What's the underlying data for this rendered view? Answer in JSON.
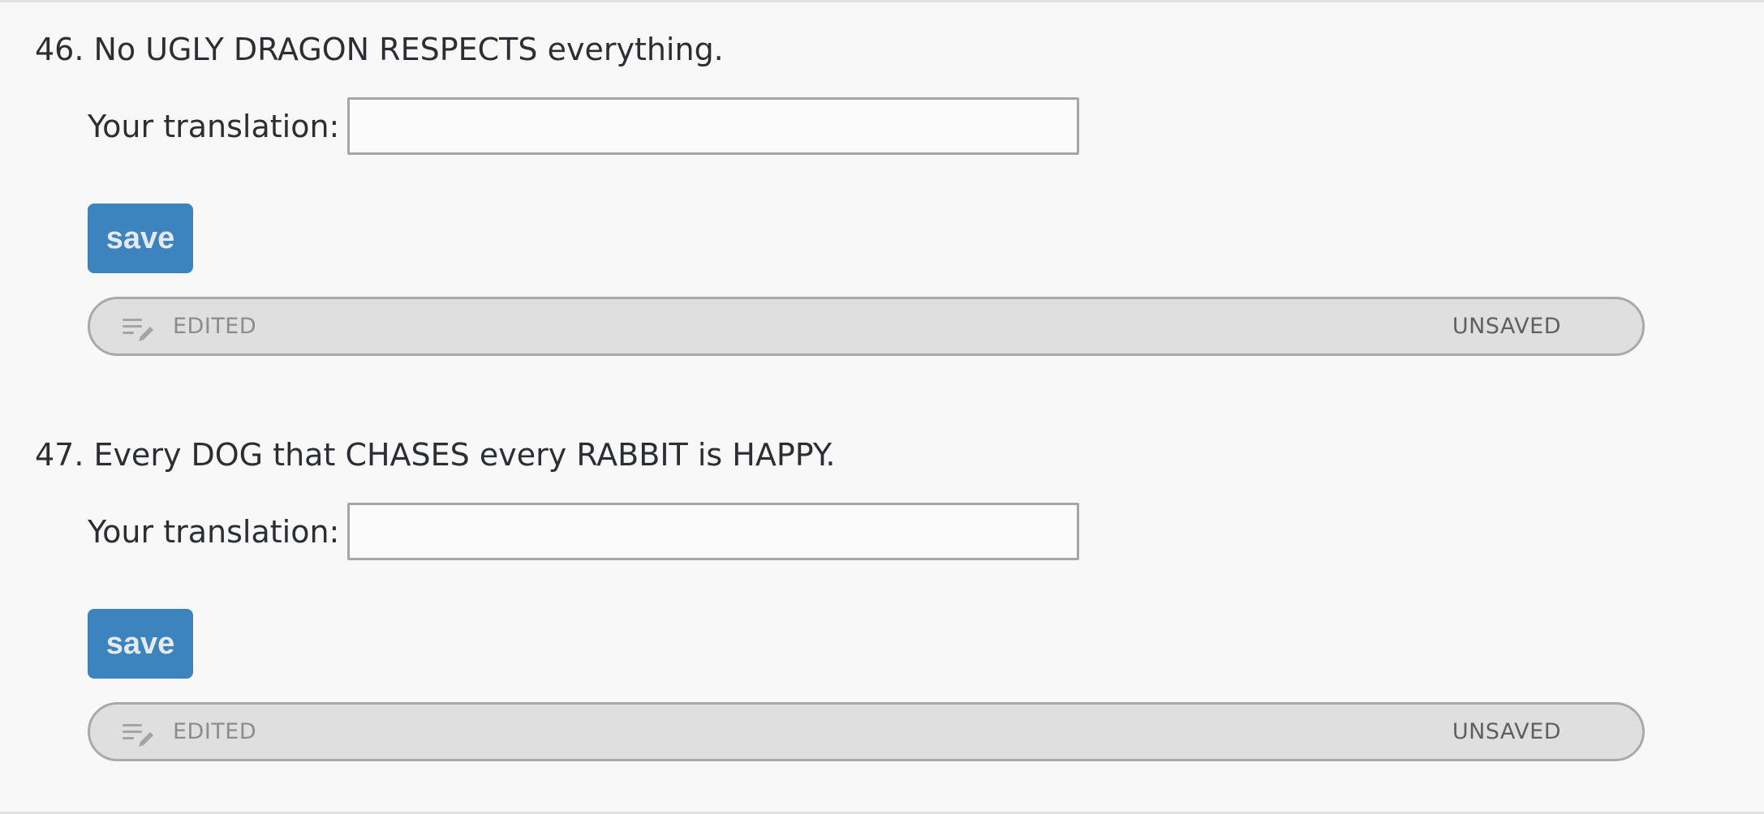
{
  "questions": [
    {
      "number": "46.",
      "text": "No UGLY DRAGON RESPECTS everything.",
      "translation_label": "Your translation:",
      "translation_value": "",
      "save_label": "save",
      "status_left": "EDITED",
      "status_right": "UNSAVED"
    },
    {
      "number": "47.",
      "text": "Every DOG that CHASES every RABBIT is HAPPY.",
      "translation_label": "Your translation:",
      "translation_value": "",
      "save_label": "save",
      "status_left": "EDITED",
      "status_right": "UNSAVED"
    }
  ],
  "icons": {
    "status": "edit-note-icon"
  },
  "colors": {
    "save_button": "#3d83bd",
    "status_bar": "#dedfde",
    "text": "#2b2f33"
  }
}
